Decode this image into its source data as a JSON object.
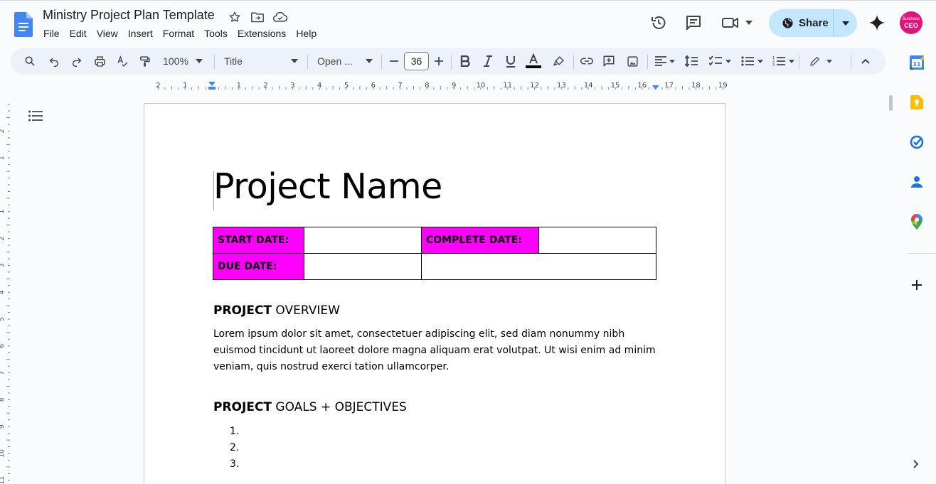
{
  "document": {
    "title": "Ministry Project Plan Template"
  },
  "menu": {
    "items": [
      "File",
      "Edit",
      "View",
      "Insert",
      "Format",
      "Tools",
      "Extensions",
      "Help"
    ]
  },
  "header": {
    "share_label": "Share",
    "avatar_top": "Business",
    "avatar_main": "CEO"
  },
  "toolbar": {
    "zoom": "100%",
    "paragraph_style": "Title",
    "font": "Open ...",
    "font_size": "36"
  },
  "ruler": {
    "h_labels": [
      "2",
      "1",
      "1",
      "2",
      "3",
      "4",
      "5",
      "6",
      "7",
      "8",
      "9",
      "10",
      "11",
      "12",
      "13",
      "14",
      "15",
      "16",
      "17",
      "18",
      "19"
    ],
    "v_labels": [
      "2",
      "1",
      "1",
      "2",
      "3",
      "4",
      "5",
      "6",
      "7",
      "8",
      "9",
      "10",
      "11"
    ]
  },
  "page": {
    "heading": "Project Name",
    "table": {
      "start_date_label": "START DATE:",
      "complete_date_label": "COMPLETE DATE:",
      "due_date_label": "DUE DATE:"
    },
    "overview": {
      "heading_bold": "PROJECT",
      "heading_rest": " OVERVIEW",
      "body": "Lorem ipsum dolor sit amet, consectetuer adipiscing elit, sed diam nonummy nibh euismod tincidunt ut laoreet dolore magna aliquam erat volutpat. Ut wisi enim ad minim veniam, quis nostrud exerci tation ullamcorper."
    },
    "goals": {
      "heading_bold": "PROJECT",
      "heading_rest": " GOALS + OBJECTIVES",
      "items": [
        "1.",
        "2.",
        "3."
      ]
    }
  },
  "colors": {
    "table_label_bg": "#ff00ff",
    "share_bg": "#c2e7ff",
    "avatar_bg": "#e3137a",
    "docs_blue": "#4285f4"
  },
  "side_panel": {
    "icons": [
      "calendar-icon",
      "keep-icon",
      "tasks-icon",
      "contacts-icon",
      "maps-icon",
      "add-icon"
    ],
    "calendar_day": "31"
  }
}
